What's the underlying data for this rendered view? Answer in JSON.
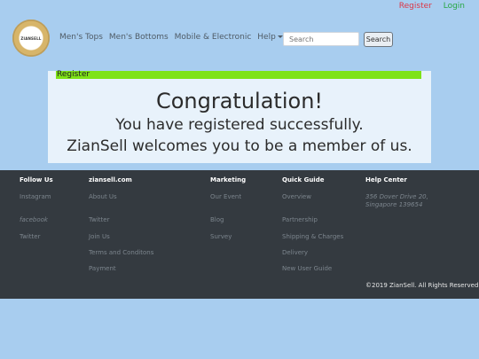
{
  "header": {
    "top_links": {
      "register": "Register",
      "login": "Login"
    },
    "logo_text": "ZIANSELL",
    "nav": [
      "Men's Tops",
      "Men's Bottoms",
      "Mobile & Electronic",
      "Help"
    ],
    "search": {
      "placeholder": "Search",
      "button": "Search"
    }
  },
  "card": {
    "header": "Register",
    "title": "Congratulation!",
    "line1": "You have registered successfully.",
    "line2": "ZianSell welcomes you to be a member of us."
  },
  "footer": {
    "follow": {
      "heading": "Follow Us",
      "links": [
        "Instagram",
        "facebook",
        "Twitter"
      ]
    },
    "site": {
      "heading": "ziansell.com",
      "links": [
        "About Us",
        "Twitter",
        "Join Us",
        "Terms and Conditons",
        "Payment"
      ]
    },
    "marketing": {
      "heading": "Marketing",
      "links": [
        "Our Event",
        "Blog",
        "Survey"
      ]
    },
    "guide": {
      "heading": "Quick Guide",
      "links": [
        "Overview",
        "Partnership",
        "Shipping & Charges",
        "Delivery",
        "New User Guide"
      ]
    },
    "help": {
      "heading": "Help Center",
      "address_line1": "356 Dover Drive 20,",
      "address_line2": "Singapore 139654"
    },
    "copyright": "©2019 ZianSell. All Rights Reserved"
  },
  "colors": {
    "background": "#a8cdef",
    "footer": "#343a40",
    "card_header": "#7ee317",
    "register": "#dc3545",
    "login": "#28a745"
  }
}
